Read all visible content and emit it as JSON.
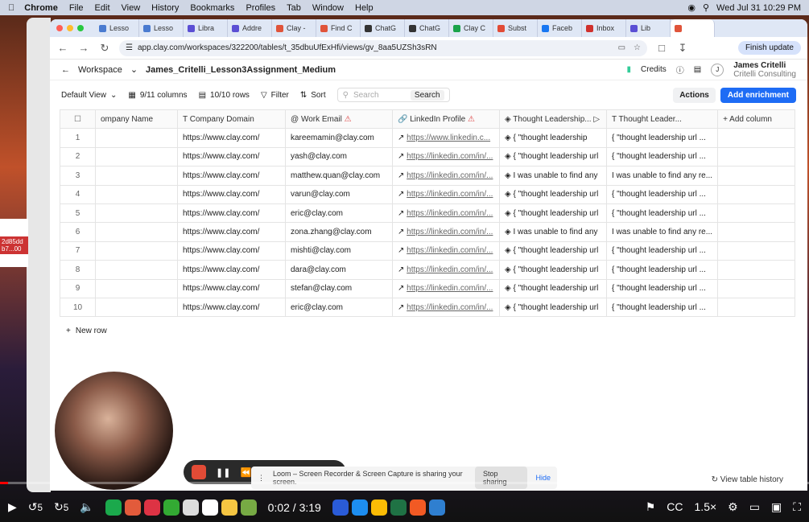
{
  "menubar": {
    "app": "Chrome",
    "items": [
      "File",
      "Edit",
      "View",
      "History",
      "Bookmarks",
      "Profiles",
      "Tab",
      "Window",
      "Help"
    ],
    "datetime": "Wed Jul 31  10:29 PM"
  },
  "desktop": {
    "thumb_text": "2d85dd b7...00"
  },
  "browser": {
    "tabs": [
      {
        "label": "Lesso",
        "color": "#4a7bd0"
      },
      {
        "label": "Lesso",
        "color": "#4a7bd0"
      },
      {
        "label": "Libra",
        "color": "#5b4fd4"
      },
      {
        "label": "Addre",
        "color": "#5b4fd4"
      },
      {
        "label": "Clay -",
        "color": "#e0543a"
      },
      {
        "label": "Find C",
        "color": "#e0543a"
      },
      {
        "label": "ChatG",
        "color": "#333333"
      },
      {
        "label": "ChatG",
        "color": "#333333"
      },
      {
        "label": "Clay C",
        "color": "#1aa34a"
      },
      {
        "label": "Subst",
        "color": "#e24b36"
      },
      {
        "label": "Faceb",
        "color": "#1877f2"
      },
      {
        "label": "Inbox",
        "color": "#d0312d"
      },
      {
        "label": "Lib",
        "color": "#5b4fd4"
      },
      {
        "label": "",
        "color": "#e0543a"
      }
    ],
    "url": "app.clay.com/workspaces/322200/tables/t_35dbuUfExHfi/views/gv_8aa5UZSh3sRN",
    "finish_update": "Finish update"
  },
  "app": {
    "workspace": "Workspace",
    "table_name": "James_Critelli_Lesson3Assignment_Medium",
    "credits": "Credits",
    "user_name": "James Critelli",
    "user_org": "Critelli Consulting",
    "user_initial": "J"
  },
  "toolbar": {
    "view": "Default View",
    "columns": "9/11 columns",
    "rows": "10/10 rows",
    "filter": "Filter",
    "sort": "Sort",
    "search_placeholder": "Search",
    "search_button": "Search",
    "actions": "Actions",
    "add_enrichment": "Add enrichment"
  },
  "table": {
    "headers": [
      "ompany Name",
      "Company Domain",
      "Work Email",
      "LinkedIn Profile",
      "Thought Leadership...",
      "Thought Leader...",
      "Add column"
    ],
    "rows": [
      {
        "n": "1",
        "domain": "https://www.clay.com/",
        "email": "kareemamin@clay.com",
        "linkedin": "https://www.linkedin.c...",
        "tl1": "{ \"thought leadership",
        "tl2": "{ \"thought leadership url ..."
      },
      {
        "n": "2",
        "domain": "https://www.clay.com/",
        "email": "yash@clay.com",
        "linkedin": "https://linkedin.com/in/...",
        "tl1": "{ \"thought leadership url",
        "tl2": "{ \"thought leadership url ..."
      },
      {
        "n": "3",
        "domain": "https://www.clay.com/",
        "email": "matthew.quan@clay.com",
        "linkedin": "https://linkedin.com/in/...",
        "tl1": "I was unable to find any",
        "tl2": "I was unable to find any re..."
      },
      {
        "n": "4",
        "domain": "https://www.clay.com/",
        "email": "varun@clay.com",
        "linkedin": "https://linkedin.com/in/...",
        "tl1": "{ \"thought leadership url",
        "tl2": "{ \"thought leadership url ..."
      },
      {
        "n": "5",
        "domain": "https://www.clay.com/",
        "email": "eric@clay.com",
        "linkedin": "https://linkedin.com/in/...",
        "tl1": "{ \"thought leadership url",
        "tl2": "{ \"thought leadership url ..."
      },
      {
        "n": "6",
        "domain": "https://www.clay.com/",
        "email": "zona.zhang@clay.com",
        "linkedin": "https://linkedin.com/in/...",
        "tl1": "I was unable to find any",
        "tl2": "I was unable to find any re..."
      },
      {
        "n": "7",
        "domain": "https://www.clay.com/",
        "email": "mishti@clay.com",
        "linkedin": "https://linkedin.com/in/...",
        "tl1": "{ \"thought leadership url",
        "tl2": "{ \"thought leadership url ..."
      },
      {
        "n": "8",
        "domain": "https://www.clay.com/",
        "email": "dara@clay.com",
        "linkedin": "https://linkedin.com/in/...",
        "tl1": "{ \"thought leadership url",
        "tl2": "{ \"thought leadership url ..."
      },
      {
        "n": "9",
        "domain": "https://www.clay.com/",
        "email": "stefan@clay.com",
        "linkedin": "https://linkedin.com/in/...",
        "tl1": "{ \"thought leadership url",
        "tl2": "{ \"thought leadership url ..."
      },
      {
        "n": "10",
        "domain": "https://www.clay.com/",
        "email": "eric@clay.com",
        "linkedin": "https://linkedin.com/in/...",
        "tl1": "{ \"thought leadership url",
        "tl2": "{ \"thought leadership url ..."
      }
    ],
    "new_row": "New row",
    "view_history": "View table history"
  },
  "loom": {
    "notice": "Loom – Screen Recorder & Screen Capture is sharing your screen.",
    "stop_sharing": "Stop sharing",
    "hide": "Hide"
  },
  "video": {
    "time_current": "0:02",
    "time_separator": "/",
    "time_total": "3:19",
    "progress": 0.01,
    "speed": "1.5×",
    "skip_back": "5",
    "skip_forward": "5",
    "cc": "CC"
  }
}
